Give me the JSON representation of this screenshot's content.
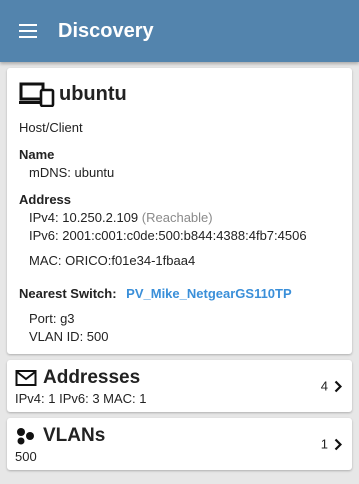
{
  "app": {
    "title": "Discovery"
  },
  "device": {
    "name": "ubuntu",
    "type": "Host/Client",
    "name_label": "Name",
    "mdns": "mDNS:  ubuntu",
    "address_label": "Address",
    "ipv4": "IPv4:  10.250.2.109",
    "ipv4_status": "(Reachable)",
    "ipv6": "IPv6:  2001:c001:c0de:500:b844:4388:4fb7:4506",
    "mac": "MAC:  ORICO:f01e34-1fbaa4",
    "nearest_switch_label": "Nearest Switch:",
    "nearest_switch": "PV_Mike_NetgearGS110TP",
    "port": "Port:  g3",
    "vlan_id": "VLAN ID:  500"
  },
  "addresses": {
    "title": "Addresses",
    "summary": "IPv4:  1   IPv6:  3   MAC:  1",
    "count": "4"
  },
  "vlans": {
    "title": "VLANs",
    "summary": "500",
    "count": "1"
  },
  "icons": {
    "menu": "hamburger-menu-icon",
    "device": "computer-phone-icon",
    "addresses": "envelope-icon",
    "vlans": "cluster-dots-icon",
    "chevron": "chevron-right-icon"
  },
  "colors": {
    "appbar": "#5384ad",
    "link": "#3a8fd9",
    "background": "#e7e7e7"
  }
}
